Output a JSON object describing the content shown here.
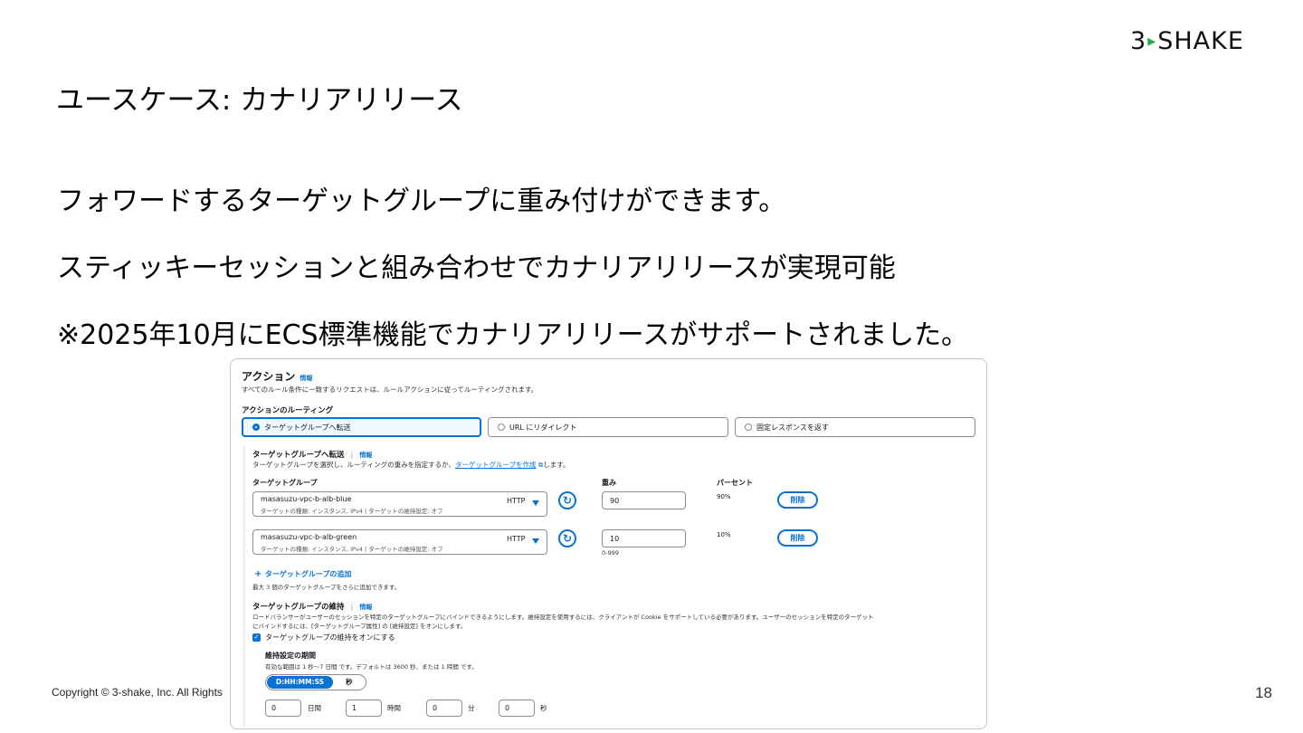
{
  "logo": {
    "left": "3",
    "mark": "▸",
    "right": "SHAKE"
  },
  "title": "ユースケース: カナリアリリース",
  "bullets": [
    "フォワードするターゲットグループに重み付けができます。",
    "スティッキーセッションと組み合わせでカナリアリリースが実現可能",
    "※2025年10月にECS標準機能でカナリアリリースがサポートされました。"
  ],
  "footer": {
    "copyright": "Copyright © 3-shake, Inc. All Rights",
    "page": "18"
  },
  "panel": {
    "heading": "アクション",
    "info": "情報",
    "description": "すべてのルール条件に一致するリクエストは、ルールアクションに従ってルーティングされます。",
    "routing_label": "アクションのルーティング",
    "routing_options": [
      "ターゲットグループへ転送",
      "URL にリダイレクト",
      "固定レスポンスを返す"
    ],
    "forward_heading": "ターゲットグループへ転送",
    "forward_desc_pre": "ターゲットグループを選択し、ルーティングの重みを指定するか、",
    "forward_desc_link": "ターゲットグループを作成",
    "forward_desc_post": "します。",
    "col_target": "ターゲットグループ",
    "col_weight": "重み",
    "col_percent": "パーセント",
    "targets": [
      {
        "name": "masasuzu-vpc-b-alb-blue",
        "detail": "ターゲットの種類: インスタンス, IPv4 | ターゲットの維持設定: オフ",
        "protocol": "HTTP",
        "weight": "90",
        "percent": "90%",
        "remove": "削除"
      },
      {
        "name": "masasuzu-vpc-b-alb-green",
        "detail": "ターゲットの種類: インスタンス, IPv4 | ターゲットの維持設定: オフ",
        "protocol": "HTTP",
        "weight": "10",
        "percent": "10%",
        "remove": "削除"
      }
    ],
    "weight_hint": "0-999",
    "add_target": "ターゲットグループの追加",
    "add_hint": "最大 3 個のターゲットグループをさらに追加できます。",
    "stickiness_heading": "ターゲットグループの維持",
    "stickiness_desc1": "ロードバランサーがユーザーのセッションを特定のターゲットグループにバインドできるようにします。維持設定を使用するには、クライアントが Cookie をサポートしている必要があります。ユーザーのセッションを特定のターゲット",
    "stickiness_desc2": "にバインドするには、[ターゲットグループ属性] の [維持設定] をオンにします。",
    "stickiness_checkbox": "ターゲットグループの維持をオンにする",
    "duration_label": "維持設定の期間",
    "duration_hint": "有効な範囲は 1 秒〜7 日間 です。デフォルトは 3600 秒、または 1 時間 です。",
    "format_on": "D:HH:MM:SS",
    "format_off": "秒",
    "duration": [
      {
        "value": "0",
        "unit": "日間"
      },
      {
        "value": "1",
        "unit": "時間"
      },
      {
        "value": "0",
        "unit": "分"
      },
      {
        "value": "0",
        "unit": "秒"
      }
    ]
  }
}
